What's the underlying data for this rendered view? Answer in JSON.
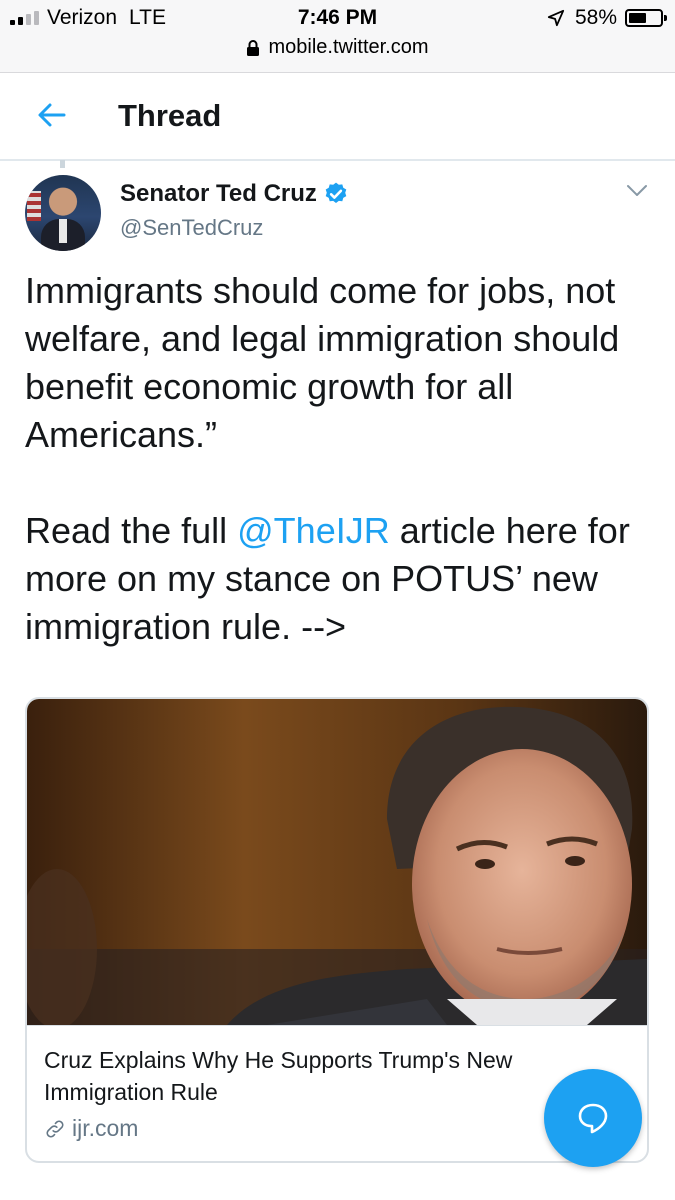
{
  "status_bar": {
    "carrier": "Verizon",
    "network": "LTE",
    "time": "7:46 PM",
    "battery": "58%",
    "battery_level": 0.58,
    "url": "mobile.twitter.com"
  },
  "header": {
    "title": "Thread"
  },
  "tweet": {
    "author_name": "Senator Ted Cruz",
    "author_handle": "@SenTedCruz",
    "text_part1": "Immigrants should come for jobs, not welfare, and legal immigration should benefit economic growth for all Americans.”\n\nRead the full ",
    "mention": "@TheIJR",
    "text_part2": " article here for more on my stance on POTUS’ new immigration rule. -->"
  },
  "card": {
    "title": "Cruz Explains Why He Supports Trump's New Immigration Rule",
    "domain": "ijr.com"
  },
  "colors": {
    "accent": "#1da1f2",
    "secondary_text": "#657786"
  },
  "icons": {
    "back": "arrow-left-icon",
    "verified": "verified-badge-icon",
    "caret": "chevron-down-icon",
    "link": "link-icon",
    "compose": "reply-bubble-icon"
  }
}
